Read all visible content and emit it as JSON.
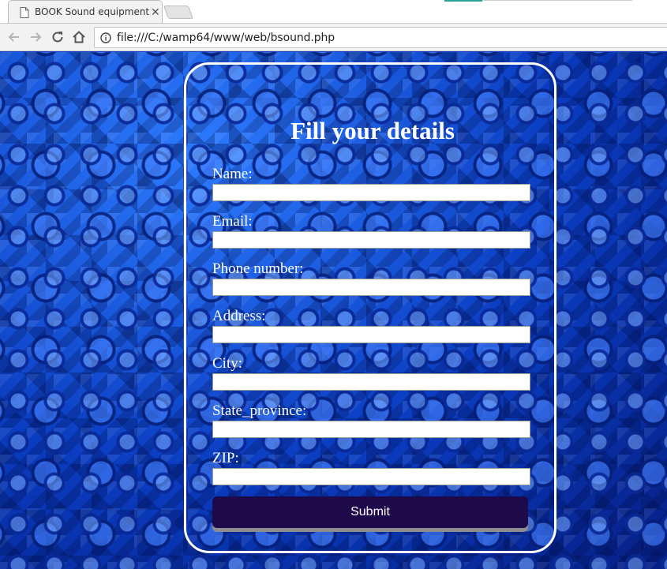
{
  "browser": {
    "tab": {
      "title": "BOOK Sound equipment",
      "close_glyph": "✕",
      "icon": "document-icon"
    },
    "url": "file:///C:/wamp64/www/web/bsound.php",
    "nav_icons": [
      "back-arrow-icon",
      "forward-arrow-icon",
      "reload-icon",
      "home-icon",
      "info-icon"
    ]
  },
  "form": {
    "title": "Fill your details",
    "fields": [
      {
        "label": "Name:",
        "value": ""
      },
      {
        "label": "Email:",
        "value": ""
      },
      {
        "label": "Phone number:",
        "value": ""
      },
      {
        "label": "Address:",
        "value": ""
      },
      {
        "label": "City:",
        "value": ""
      },
      {
        "label": "State_province:",
        "value": ""
      },
      {
        "label": "ZIP:",
        "value": ""
      }
    ],
    "submit_label": "Submit"
  },
  "colors": {
    "background_blue": "#0b44c8",
    "card_border": "#ffffff",
    "submit_bg": "#1e0a4a",
    "tab_accent": "#2aa39a"
  }
}
